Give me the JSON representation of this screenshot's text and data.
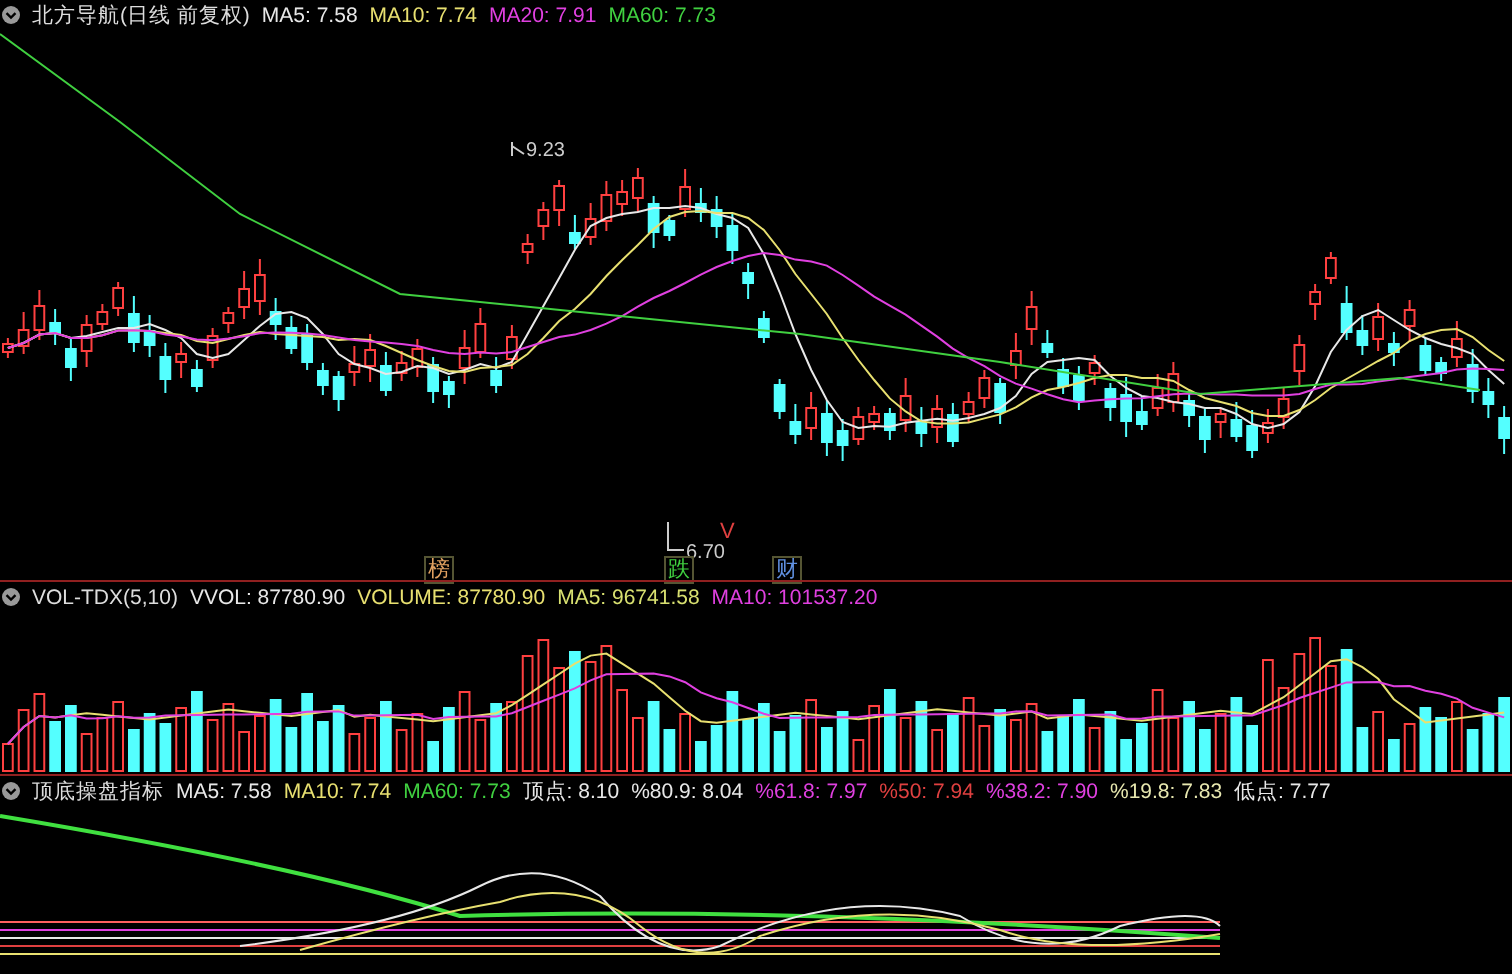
{
  "price_panel": {
    "title": "北方导航(日线 前复权)",
    "indicators": [
      {
        "label": "MA5: 7.58",
        "color": "#e8e8e8"
      },
      {
        "label": "MA10: 7.74",
        "color": "#e8e070"
      },
      {
        "label": "MA20: 7.91",
        "color": "#e040e0"
      },
      {
        "label": "MA60: 7.73",
        "color": "#40d040"
      }
    ],
    "high_label": "9.23",
    "low_label": "6.70",
    "markers": [
      {
        "text": "榜",
        "color": "#e0a060"
      },
      {
        "text": "跌",
        "color": "#40d040"
      },
      {
        "text": "财",
        "color": "#6090e0"
      },
      {
        "text": "V",
        "color": "#e04040"
      }
    ]
  },
  "volume_panel": {
    "title": "VOL-TDX(5,10)",
    "indicators": [
      {
        "label": "VVOL: 87780.90",
        "color": "#e8e8e8"
      },
      {
        "label": "VOLUME: 87780.90",
        "color": "#e8e070"
      },
      {
        "label": "MA5: 96741.58",
        "color": "#d8e070"
      },
      {
        "label": "MA10: 101537.20",
        "color": "#e040e0"
      }
    ]
  },
  "indicator_panel": {
    "title": "顶底操盘指标",
    "indicators": [
      {
        "label": "MA5: 7.58",
        "color": "#e8e8e8"
      },
      {
        "label": "MA10: 7.74",
        "color": "#e8e070"
      },
      {
        "label": "MA60: 7.73",
        "color": "#40d040"
      },
      {
        "label": "顶点: 8.10",
        "color": "#e8e8e8"
      },
      {
        "label": "%80.9: 8.04",
        "color": "#e8e8e8"
      },
      {
        "label": "%61.8: 7.97",
        "color": "#e040e0"
      },
      {
        "label": "%50: 7.94",
        "color": "#e04040"
      },
      {
        "label": "%38.2: 7.90",
        "color": "#e040e0"
      },
      {
        "label": "%19.8: 7.83",
        "color": "#e8e8b0"
      },
      {
        "label": "低点: 7.77",
        "color": "#e8e8e8"
      }
    ]
  }
}
